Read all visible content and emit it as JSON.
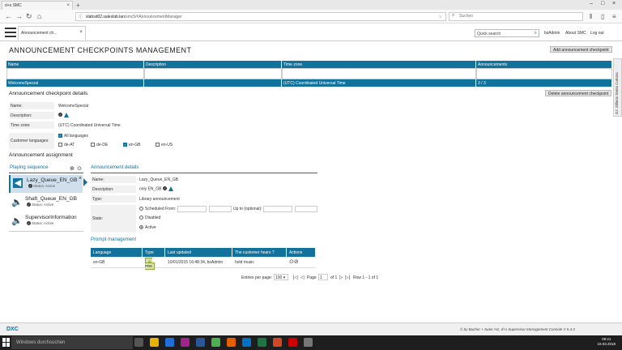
{
  "browser": {
    "tab_title": "d+s SMC",
    "url_host": "slabsd02.saleslab.lan",
    "url_path": "/smc5/#AnnouncementManager",
    "search_placeholder": "Suchen"
  },
  "app": {
    "tab_label": "Announcement ch...",
    "quick_search_placeholder": "Quick search",
    "user": "bsAdmin",
    "about": "About SMC",
    "logout": "Log out"
  },
  "page": {
    "title": "Announcement checkpoints management",
    "add_button": "Add announcement checkpoint",
    "delete_button": "Delete announcement checkpoint",
    "side_tab": "DJ: Zillions Swiss Cuttons"
  },
  "grid": {
    "columns": [
      "Name",
      "Description",
      "Time zone",
      "Announcements"
    ],
    "row": [
      "WelcomeSpecial",
      "",
      "(UTC) Coordinated Universal Time",
      "3 / 3"
    ]
  },
  "details": {
    "title": "Announcement checkpoint details",
    "name_label": "Name:",
    "name_value": "WelcomeSpecial",
    "desc_label": "Description:",
    "tz_label": "Time zone:",
    "tz_value": "(UTC) Coordinated Universal Time",
    "lang_label": "Customer languages:",
    "all_languages": "All languages",
    "languages": [
      "de-AT",
      "de-DE",
      "en-GB",
      "en-US"
    ]
  },
  "assignment": {
    "title": "Announcement assignment",
    "playing_sequence": "Playing sequence",
    "items": [
      {
        "name": "Lazy_Queue_EN_GB",
        "status": "Status: Active"
      },
      {
        "name": "Shaft_Queue_EN_GB",
        "status": "Status: Active"
      },
      {
        "name": "SupervisorInformation",
        "status": "Status: Active"
      }
    ]
  },
  "ann_details": {
    "title": "Announcement details",
    "name_label": "Name:",
    "name_value": "Lazy_Queue_EN_GB",
    "desc_label": "Description:",
    "desc_value": "only EN_GB",
    "type_label": "Type:",
    "type_value": "Library announcement",
    "state_label": "State:",
    "scheduled": "Scheduled",
    "from": "From:",
    "up_to": "Up to (optional):",
    "disabled": "Disabled",
    "active": "Active"
  },
  "prompt": {
    "title": "Prompt management",
    "columns": [
      "Language",
      "Type",
      "Last updated",
      "The customer hears",
      "Actions"
    ],
    "row": {
      "language": "en-GB",
      "type": "PRE",
      "updated": "10/01/2015 16:48:34, bsAdmin",
      "hears": "hold music"
    }
  },
  "pager": {
    "entries_label": "Entries per page:",
    "entries_value": "100",
    "page_label": "Page",
    "page_value": "1",
    "of": "of 1",
    "rows": "Row 1 - 1 of 1"
  },
  "footer": {
    "logo": "DXC",
    "copyright": "© by Bucher + Suter AG, d+s Supervisor Management Console V 5.4.3"
  },
  "taskbar": {
    "search": "Windows durchsuchen",
    "time": "09:21",
    "date": "15.03.2018"
  },
  "colors": {
    "accent": "#11729b"
  }
}
